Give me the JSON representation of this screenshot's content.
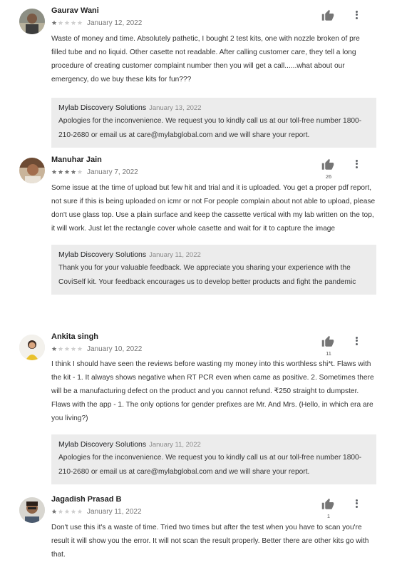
{
  "reviews": [
    {
      "author": "Gaurav Wani",
      "rating": 1,
      "date": "January 12, 2022",
      "helpful_count": "",
      "text": "Waste of money and time. Absolutely pathetic, I bought 2 test kits, one with nozzle broken of pre filled tube and no liquid. Other casette not readable. After calling customer care, they tell a long procedure of creating customer complaint number then you will get a call......what about our emergency, do we buy these kits for fun???",
      "reply": {
        "developer": "Mylab Discovery Solutions",
        "date": "January 13, 2022",
        "text": "Apologies for the inconvenience. We request you to kindly call us at our toll-free number 1800-210-2680 or email us at care@mylabglobal.com and we will share your report."
      }
    },
    {
      "author": "Manuhar Jain",
      "rating": 4,
      "date": "January 7, 2022",
      "helpful_count": "26",
      "text": "Some issue at the time of upload but few hit and trial and it is uploaded. You get a proper pdf report, not sure if this is being uploaded on icmr or not For people complain about not able to upload, please don't use glass top. Use a plain surface and keep the cassette vertical with my lab written on the top, it will work. Just let the rectangle cover whole casette and wait for it to capture the image",
      "reply": {
        "developer": "Mylab Discovery Solutions",
        "date": "January 11, 2022",
        "text": "Thank you for your valuable feedback. We appreciate you sharing your experience with the CoviSelf kit. Your feedback encourages us to develop better products and fight the pandemic"
      }
    },
    {
      "author": "Ankita singh",
      "rating": 1,
      "date": "January 10, 2022",
      "helpful_count": "11",
      "text": "I think I should have seen the reviews before wasting my money into this worthless shi*t. Flaws with the kit - 1. It always shows negative when RT PCR even when came as positive. 2. Sometimes there will be a manufacturing defect on the product and you cannot refund. ₹250 straight to dumpster. Flaws with the app - 1. The only options for gender prefixes are Mr. And Mrs. (Hello, in which era are you living?)",
      "reply": {
        "developer": "Mylab Discovery Solutions",
        "date": "January 11, 2022",
        "text": "Apologies for the inconvenience. We request you to kindly call us at our toll-free number 1800-210-2680 or email us at care@mylabglobal.com and we will share your report."
      }
    },
    {
      "author": "Jagadish Prasad B",
      "rating": 1,
      "date": "January 11, 2022",
      "helpful_count": "1",
      "text": "Don't use this it's a waste of time. Tried two times but after the test when you have to scan you're result it will show you the error. It will not scan the result properly. Better there are other kits go with that."
    }
  ],
  "colors": {
    "star_filled": "#757575",
    "star_empty": "#cfcfcf",
    "reply_bg": "#ececec",
    "thumb": "#757575"
  },
  "icons": {
    "thumb": "thumbs-up-icon",
    "menu": "more-vert-icon"
  }
}
